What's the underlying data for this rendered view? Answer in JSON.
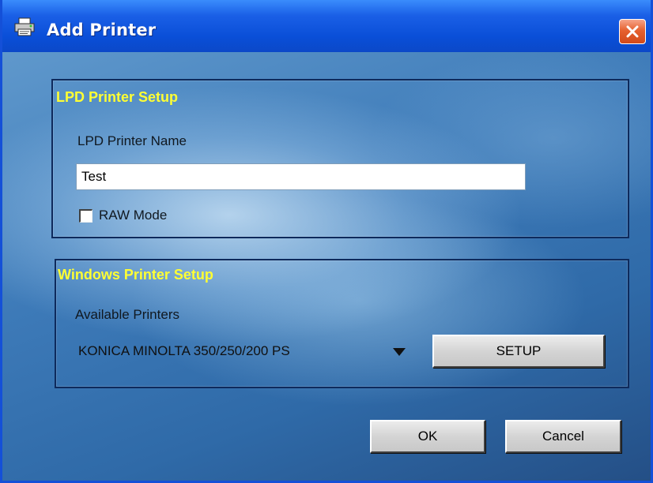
{
  "window": {
    "title": "Add Printer",
    "icon": "printer-icon",
    "close_icon": "close-icon"
  },
  "lpd": {
    "group_title": "LPD Printer Setup",
    "name_label": "LPD Printer Name",
    "name_value": "Test",
    "raw_label": "RAW Mode",
    "raw_checked": false
  },
  "windows": {
    "group_title": "Windows Printer Setup",
    "available_label": "Available Printers",
    "selected_printer": "KONICA MINOLTA 350/250/200 PS",
    "setup_label": "SETUP"
  },
  "buttons": {
    "ok_label": "OK",
    "cancel_label": "Cancel"
  },
  "colors": {
    "group_title": "#ffff33",
    "titlebar": "#0a4fd8",
    "close_button": "#e6612f"
  }
}
